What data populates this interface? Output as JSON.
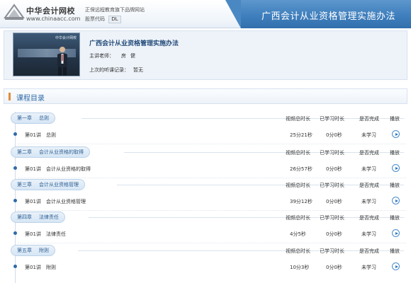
{
  "header": {
    "logo_name": "中华会计网校",
    "logo_url": "www.chinaacc.com",
    "slogan_line1": "正保远程教育旗下品牌网站",
    "stock_label": "股票代码",
    "stock_code": "DL",
    "page_title": "广西会计从业资格管理实施办法"
  },
  "course": {
    "title": "广西会计从业资格管理实施办法",
    "teacher_label": "主讲老师：",
    "teacher_name": "房健",
    "record_label": "上次的听课记录：",
    "record_value": "暂无",
    "thumb_caption": "中华会计网校"
  },
  "catalog": {
    "title": "课程目录",
    "columns": [
      "视频总时长",
      "已学习时长",
      "是否完成",
      "播放"
    ],
    "chapters": [
      {
        "number": "第一章",
        "name": "总则",
        "lectures": [
          {
            "number": "第01讲",
            "name": "总则",
            "total": "25分21秒",
            "learned": "0分0秒",
            "status": "未学习"
          }
        ]
      },
      {
        "number": "第二章",
        "name": "会计从业资格的取得",
        "lectures": [
          {
            "number": "第01讲",
            "name": "会计从业资格的取得",
            "total": "26分57秒",
            "learned": "0分0秒",
            "status": "未学习"
          }
        ]
      },
      {
        "number": "第三章",
        "name": "会计从业资格管理",
        "lectures": [
          {
            "number": "第01讲",
            "name": "会计从业资格管理",
            "total": "39分12秒",
            "learned": "0分0秒",
            "status": "未学习"
          }
        ]
      },
      {
        "number": "第四章",
        "name": "法律责任",
        "lectures": [
          {
            "number": "第01讲",
            "name": "法律责任",
            "total": "4分5秒",
            "learned": "0分0秒",
            "status": "未学习"
          }
        ]
      },
      {
        "number": "第五章",
        "name": "附则",
        "lectures": [
          {
            "number": "第01讲",
            "name": "附则",
            "total": "10分3秒",
            "learned": "0分0秒",
            "status": "未学习"
          }
        ]
      }
    ]
  },
  "colors": {
    "accent_blue": "#2f6aa7",
    "header_blue": "#3f7fbd",
    "orange_marker": "#e3893b"
  }
}
